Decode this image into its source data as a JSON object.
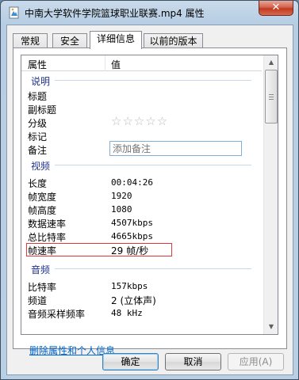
{
  "window": {
    "title": "中南大学软件学院篮球职业联赛.mp4 属性",
    "close_glyph": "✕"
  },
  "tabs": [
    {
      "label": "常规"
    },
    {
      "label": "安全"
    },
    {
      "label": "详细信息"
    },
    {
      "label": "以前的版本"
    }
  ],
  "columns": {
    "property": "属性",
    "value": "值"
  },
  "groups": {
    "description": {
      "title": "说明",
      "rows": [
        {
          "name": "标题",
          "value": ""
        },
        {
          "name": "副标题",
          "value": ""
        },
        {
          "name": "分级",
          "stars": "☆☆☆☆☆",
          "rating": 0
        },
        {
          "name": "标记",
          "value": ""
        },
        {
          "name": "备注",
          "placeholder": "添加备注"
        }
      ]
    },
    "video": {
      "title": "视频",
      "rows": [
        {
          "name": "长度",
          "value": "00:04:26"
        },
        {
          "name": "帧宽度",
          "value": "1920"
        },
        {
          "name": "帧高度",
          "value": "1080"
        },
        {
          "name": "数据速率",
          "value": "4507kbps"
        },
        {
          "name": "总比特率",
          "value": "4665kbps"
        },
        {
          "name": "帧速率",
          "value": "29 帧/秒"
        }
      ]
    },
    "audio": {
      "title": "音频",
      "rows": [
        {
          "name": "比特率",
          "value": "157kbps"
        },
        {
          "name": "频道",
          "value": "2 (立体声)"
        },
        {
          "name": "音频采样频率",
          "value": "48 kHz"
        }
      ]
    }
  },
  "links": {
    "remove_properties": "删除属性和个人信息"
  },
  "buttons": {
    "ok": "确定",
    "cancel": "取消",
    "apply": "应用(A)"
  },
  "colors": {
    "highlight_border": "#e03a3a",
    "group_title": "#1e3287",
    "link": "#0066cc"
  }
}
